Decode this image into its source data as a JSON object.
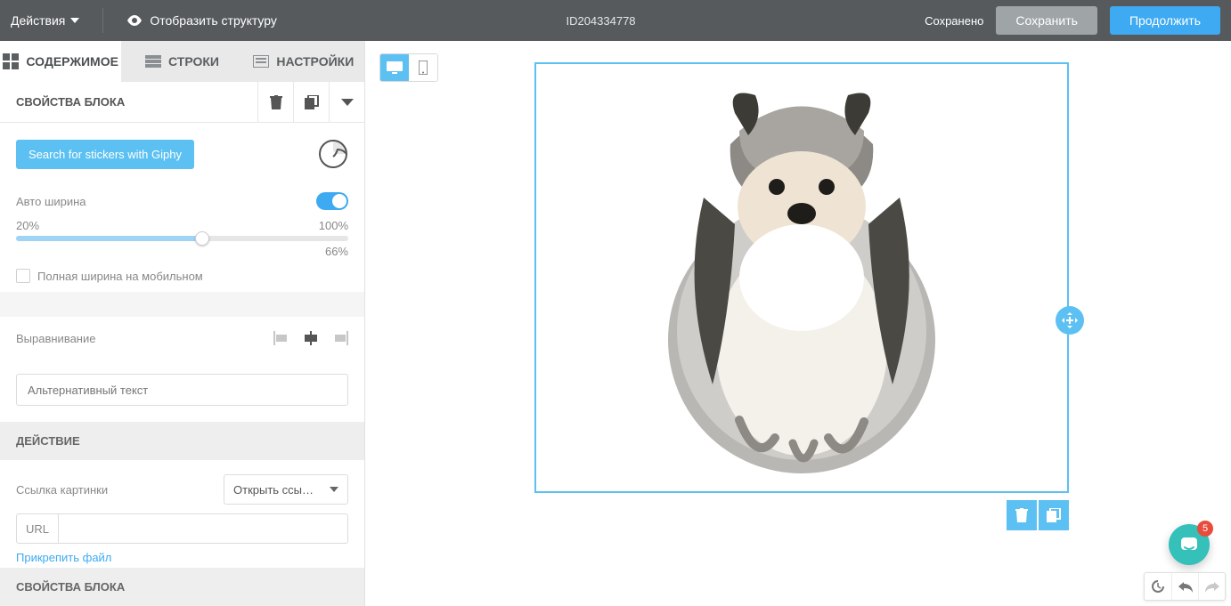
{
  "topbar": {
    "actions_label": "Действия",
    "structure_label": "Отобразить структуру",
    "id_text": "ID204334778",
    "saved_label": "Сохранено",
    "save_btn": "Сохранить",
    "continue_btn": "Продолжить"
  },
  "tabs": {
    "content": "СОДЕРЖИМОЕ",
    "rows": "СТРОКИ",
    "settings": "НАСТРОЙКИ"
  },
  "block_props_title": "СВОЙСТВА БЛОКА",
  "giphy_btn": "Search for stickers with Giphy",
  "width": {
    "auto_label": "Авто ширина",
    "min": "20%",
    "max": "100%",
    "value": "66%",
    "percent": 56,
    "full_mobile": "Полная ширина на мобильном"
  },
  "align_label": "Выравнивание",
  "alt_placeholder": "Альтернативный текст",
  "action_title": "ДЕЙСТВИЕ",
  "link": {
    "label": "Ссылка картинки",
    "select_text": "Открыть ссы…"
  },
  "url_prefix": "URL",
  "attach_link": "Прикрепить файл",
  "footer_block_props": "СВОЙСТВА БЛОКА",
  "chat_badge": "5"
}
